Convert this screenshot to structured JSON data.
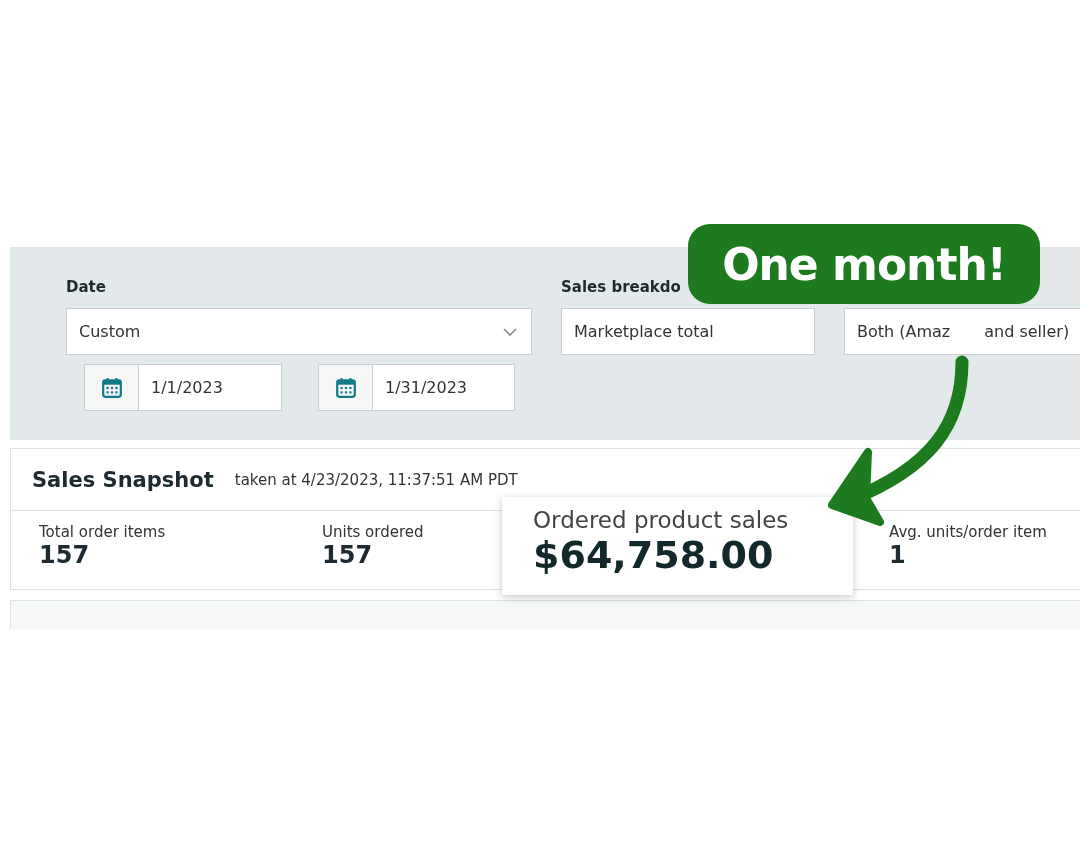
{
  "date_filter": {
    "label": "Date",
    "value": "Custom",
    "start": "1/1/2023",
    "end": "1/31/2023"
  },
  "breakdown_filter": {
    "label": "Sales breakdo",
    "value": "Marketplace total"
  },
  "fulfillment_filter": {
    "value_parts": [
      "Both (Amaz",
      "and seller)"
    ]
  },
  "snapshot": {
    "title": "Sales Snapshot",
    "timestamp": "taken at 4/23/2023, 11:37:51 AM PDT",
    "metrics": [
      {
        "label": "Total order items",
        "value": "157",
        "highlighted": false
      },
      {
        "label": "Units ordered",
        "value": "157",
        "highlighted": false
      },
      {
        "label": "Ordered product sales",
        "value": "$64,758.00",
        "highlighted": true
      },
      {
        "label": "Avg. units/order item",
        "value": "1",
        "highlighted": false
      }
    ]
  },
  "callout": {
    "text": "One month!"
  }
}
